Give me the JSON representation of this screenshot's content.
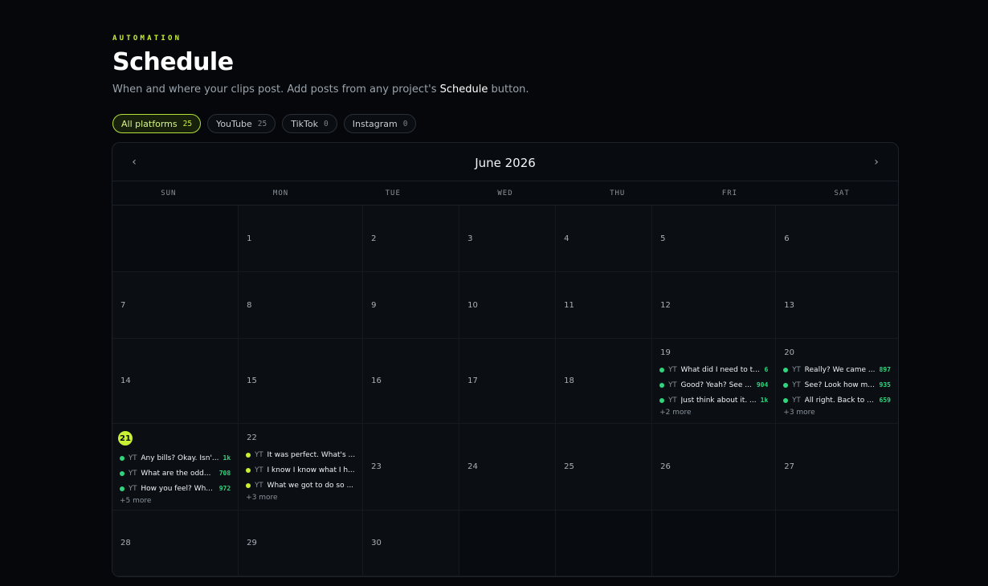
{
  "header": {
    "eyebrow": "AUTOMATION",
    "title": "Schedule",
    "subtitle_before": "When and where your clips post. Add posts from any project's ",
    "subtitle_bold": "Schedule",
    "subtitle_after": " button."
  },
  "filters": [
    {
      "label": "All platforms",
      "count": "25"
    },
    {
      "label": "YouTube",
      "count": "25"
    },
    {
      "label": "TikTok",
      "count": "0"
    },
    {
      "label": "Instagram",
      "count": "0"
    }
  ],
  "calendar": {
    "month": "June 2026",
    "prev_icon": "‹",
    "next_icon": "›",
    "weekdays": [
      "SUN",
      "MON",
      "TUE",
      "WED",
      "THU",
      "FRI",
      "SAT"
    ]
  },
  "days": {
    "d1": "1",
    "d2": "2",
    "d3": "3",
    "d4": "4",
    "d5": "5",
    "d6": "6",
    "d7": "7",
    "d8": "8",
    "d9": "9",
    "d10": "10",
    "d11": "11",
    "d12": "12",
    "d13": "13",
    "d14": "14",
    "d15": "15",
    "d16": "16",
    "d17": "17",
    "d18": "18",
    "d19": {
      "num": "19",
      "posts": [
        {
          "platform": "YT",
          "title": "What did I need to t...",
          "views": "6"
        },
        {
          "platform": "YT",
          "title": "Good? Yeah? See ...",
          "views": "904"
        },
        {
          "platform": "YT",
          "title": "Just think about it. ...",
          "views": "1k"
        }
      ],
      "more": "+2 more"
    },
    "d20": {
      "num": "20",
      "posts": [
        {
          "platform": "YT",
          "title": "Really? We came ...",
          "views": "897"
        },
        {
          "platform": "YT",
          "title": "See? Look how m...",
          "views": "935"
        },
        {
          "platform": "YT",
          "title": "All right. Back to ...",
          "views": "659"
        }
      ],
      "more": "+3 more"
    },
    "d21": {
      "num": "21",
      "posts": [
        {
          "platform": "YT",
          "title": "Any bills? Okay. Isn'...",
          "views": "1k"
        },
        {
          "platform": "YT",
          "title": "What are the odd...",
          "views": "708"
        },
        {
          "platform": "YT",
          "title": "How you feel? Wh...",
          "views": "972"
        }
      ],
      "more": "+5 more"
    },
    "d22": {
      "num": "22",
      "posts": [
        {
          "platform": "YT",
          "title": "It was perfect. What's ..."
        },
        {
          "platform": "YT",
          "title": "I know I know what I h..."
        },
        {
          "platform": "YT",
          "title": "What we got to do so ..."
        }
      ],
      "more": "+3 more"
    },
    "d23": "23",
    "d24": "24",
    "d25": "25",
    "d26": "26",
    "d27": "27",
    "d28": "28",
    "d29": "29",
    "d30": "30"
  },
  "colors": {
    "accent": "#c8f035",
    "published": "#2fd67e",
    "background": "#05070a"
  }
}
